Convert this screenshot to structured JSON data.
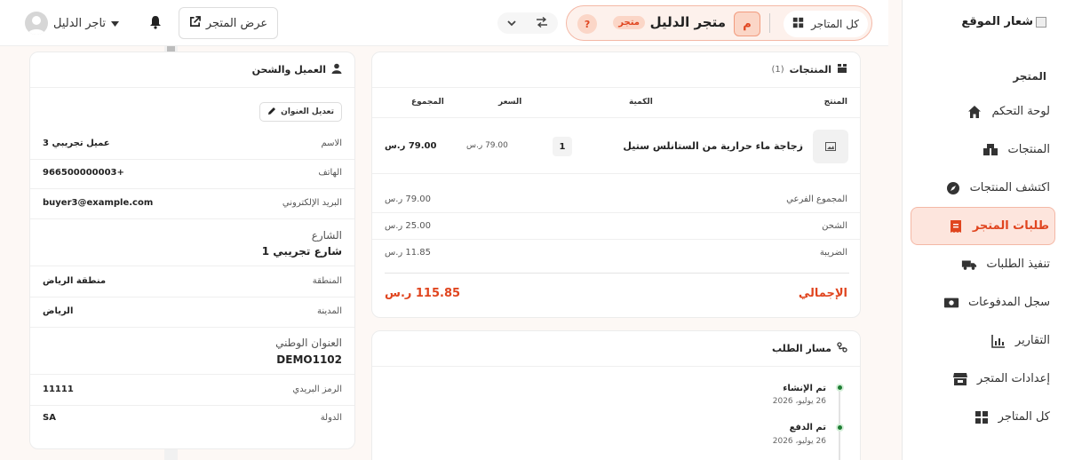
{
  "sidebar": {
    "logo_text": "شعار الموقع",
    "section_title": "المتجر",
    "items": [
      {
        "label": "لوحة التحكم",
        "icon": "home-icon"
      },
      {
        "label": "المنتجات",
        "icon": "boxes-icon"
      },
      {
        "label": "اكتشف المنتجات",
        "icon": "compass-icon"
      },
      {
        "label": "طلبات المتجر",
        "icon": "receipt-icon"
      },
      {
        "label": "تنفيذ الطلبات",
        "icon": "truck-icon"
      },
      {
        "label": "سجل المدفوعات",
        "icon": "money-icon"
      },
      {
        "label": "التقارير",
        "icon": "chart-icon"
      },
      {
        "label": "إعدادات المتجر",
        "icon": "store-icon"
      },
      {
        "label": "كل المتاجر",
        "icon": "grid-icon"
      }
    ]
  },
  "topbar": {
    "all_stores_label": "كل المتاجر",
    "store_initial": "م",
    "store_name": "متجر الدليل",
    "store_tag": "متجر",
    "help_label": "?",
    "view_store_label": "عرض المتجر",
    "user_name": "تاجر الدليل"
  },
  "products": {
    "title": "المنتجات",
    "count": "(1)",
    "headers": {
      "product": "المنتج",
      "quantity": "الكمية",
      "price": "السعر",
      "total": "المجموع"
    },
    "item": {
      "name": "زجاجة ماء حرارية من الستانلس ستيل",
      "quantity": "1",
      "price": "79.00 ر.س",
      "total": "79.00 ر.س"
    },
    "summary": [
      {
        "label": "المجموع الفرعي",
        "value": "79.00 ر.س"
      },
      {
        "label": "الشحن",
        "value": "25.00 ر.س"
      },
      {
        "label": "الضريبة",
        "value": "11.85 ر.س"
      }
    ],
    "grand_total_label": "الإجمالي",
    "grand_total_value": "115.85 ر.س"
  },
  "timeline": {
    "title": "مسار الطلب",
    "events": [
      {
        "title": "تم الإنشاء",
        "date": "26 يوليو، 2026"
      },
      {
        "title": "تم الدفع",
        "date": "26 يوليو، 2026"
      }
    ]
  },
  "customer": {
    "title": "العميل والشحن",
    "edit_label": "تعديل العنوان",
    "name_label": "الاسم",
    "name_value": "عميل تجريبي 3",
    "phone_label": "الهاتف",
    "phone_value": "+966500000003",
    "email_label": "البريد الإلكتروني",
    "email_value": "buyer3@example.com",
    "street_label": "الشارع",
    "street_value": "شارع تجريبي 1",
    "region_label": "المنطقة",
    "region_value": "منطقة الرياض",
    "city_label": "المدينة",
    "city_value": "الرياض",
    "national_label": "العنوان الوطني",
    "national_value": "DEMO1102",
    "postal_label": "الرمز البريدي",
    "postal_value": "11111",
    "country_label": "الدولة",
    "country_value": "SA"
  },
  "colors": {
    "accent": "#e0451f",
    "accent_soft": "#fde5dd",
    "success": "#1e7e34"
  }
}
